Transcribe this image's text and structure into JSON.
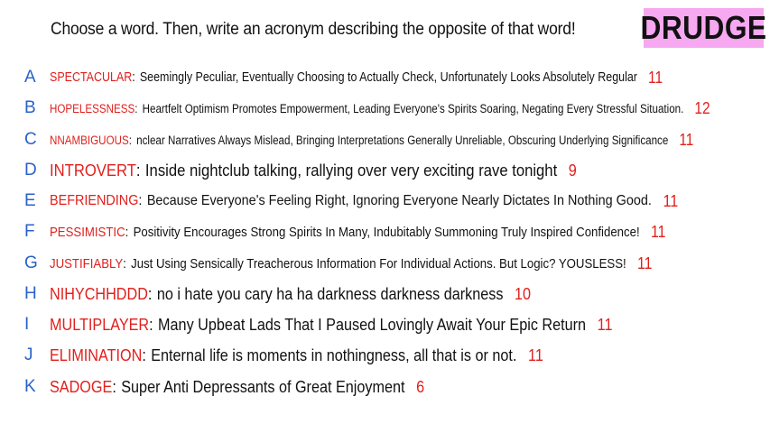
{
  "header": {
    "prompt": "Choose a word. Then, write an acronym describing the opposite of that word!",
    "logo_text": "DRUDGE"
  },
  "colors": {
    "logo_bg": "#f6a8f0",
    "letter": "#2a62c9",
    "word": "#e0201c",
    "text": "#111111"
  },
  "rows": [
    {
      "letter": "A",
      "word": "SPECTACULAR",
      "text": "Seemingly Peculiar, Eventually Choosing to Actually Check, Unfortunately Looks Absolutely Regular",
      "count": "11"
    },
    {
      "letter": "B",
      "word": "HOPELESSNESS",
      "text": "Heartfelt Optimism Promotes Empowerment, Leading Everyone's Spirits Soaring, Negating Every Stressful Situation.",
      "count": "12"
    },
    {
      "letter": "C",
      "word": "NNAMBIGUOUS",
      "text": "nclear Narratives Always Mislead, Bringing Interpretations Generally Unreliable, Obscuring Underlying Significance",
      "count": "11"
    },
    {
      "letter": "D",
      "word": "INTROVERT",
      "text": "Inside nightclub talking, rallying over very exciting rave tonight",
      "count": "9"
    },
    {
      "letter": "E",
      "word": "BEFRIENDING",
      "text": "Because Everyone's Feeling Right, Ignoring Everyone Nearly Dictates In Nothing Good.",
      "count": "11"
    },
    {
      "letter": "F",
      "word": "PESSIMISTIC",
      "text": "Positivity Encourages Strong Spirits In Many, Indubitably Summoning Truly Inspired Confidence!",
      "count": "11"
    },
    {
      "letter": "G",
      "word": "JUSTIFIABLY",
      "text": "Just Using Sensically Treacherous Information For Individual Actions. But Logic? YOUSLESS!",
      "count": "11"
    },
    {
      "letter": "H",
      "word": "NIHYCHHDDD",
      "text": "no i hate you cary ha ha darkness darkness darkness",
      "count": "10"
    },
    {
      "letter": "I",
      "word": "MULTIPLAYER",
      "text": "Many Upbeat Lads That I Paused Lovingly Await Your Epic Return",
      "count": "11"
    },
    {
      "letter": "J",
      "word": "ELIMINATION",
      "text": "Enternal life is moments in nothingness, all that is or not.",
      "count": "11"
    },
    {
      "letter": "K",
      "word": "SADOGE",
      "text": "Super Anti Depressants of Great Enjoyment",
      "count": "6"
    }
  ]
}
